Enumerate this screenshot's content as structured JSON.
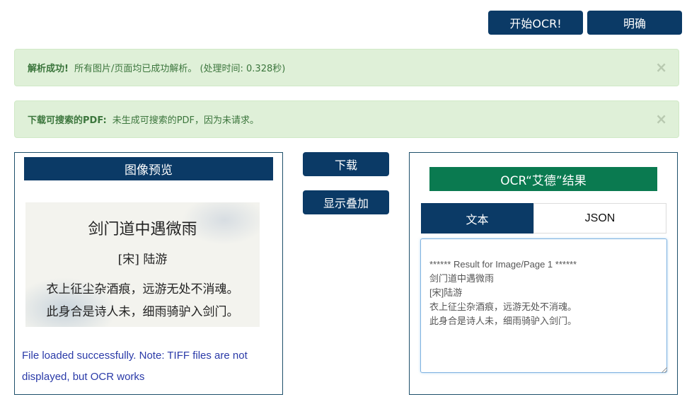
{
  "toolbar": {
    "start_label": "开始OCR!",
    "clear_label": "明确"
  },
  "alerts": [
    {
      "title": "解析成功!",
      "message": "所有图片/页面均已成功解析。 (处理时间: 0.328秒)",
      "close": "×"
    },
    {
      "title": "下载可搜索的PDF:",
      "message": "未生成可搜索的PDF，因为未请求。",
      "close": "×"
    }
  ],
  "preview": {
    "title": "图像预览",
    "image": {
      "poem_title": "剑门道中遇微雨",
      "author": "[宋] 陆游",
      "line1": "衣上征尘杂酒痕，远游无处不消魂。",
      "line2": "此身合是诗人未，细雨骑驴入剑门。"
    },
    "note": "File loaded successfully. Note: TIFF files are not displayed, but OCR works"
  },
  "actions": {
    "download_label": "下载",
    "overlay_label": "显示叠加"
  },
  "result": {
    "title": "OCR“艾德”结果",
    "tabs": [
      "文本",
      "JSON"
    ],
    "text": "****** Result for Image/Page 1 ******\n剑门道中遇微雨\n[宋]陆游\n衣上征尘杂酒痕，远游无处不消魂。\n此身合是诗人未，细雨骑驴入剑门。"
  },
  "colors": {
    "primary": "#0b3a66",
    "accent_green": "#0a7a50",
    "alert_bg": "#dff0d8",
    "alert_text": "#3c763d"
  }
}
